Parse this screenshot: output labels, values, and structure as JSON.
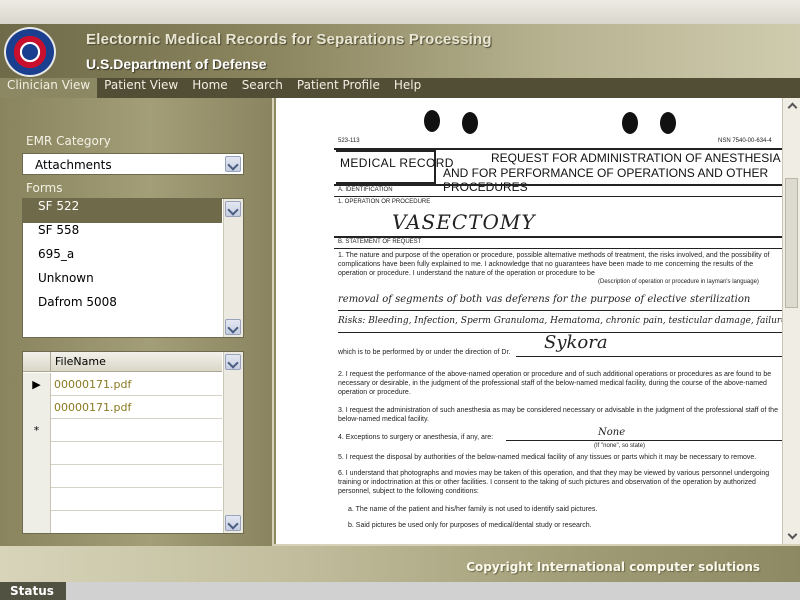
{
  "header": {
    "app_title": "Electornic Medical Records for Separations Processing",
    "org_title": "U.S.Department of Defense",
    "logo_icon": "dod-seal-icon"
  },
  "menu": [
    {
      "label": "Clinician View",
      "active": true
    },
    {
      "label": "Patient View",
      "active": false
    },
    {
      "label": "Home",
      "active": false
    },
    {
      "label": "Search",
      "active": false
    },
    {
      "label": "Patient Profile",
      "active": false
    },
    {
      "label": "Help",
      "active": false
    }
  ],
  "left_panel": {
    "emr_category_label": "EMR Category",
    "emr_category_value": "Attachments",
    "forms_label": "Forms",
    "forms": [
      "SF 522",
      "SF 558",
      "695_a",
      "Unknown",
      "Dafrom 5008"
    ],
    "selected_form": "SF 522",
    "file_grid": {
      "column": "FileName",
      "rows": [
        {
          "marker": "▶",
          "file": "00000171.pdf"
        },
        {
          "marker": "",
          "file": "00000171.pdf"
        },
        {
          "marker": "*",
          "file": ""
        }
      ]
    }
  },
  "document": {
    "form_no": "523-113",
    "nsn": "NSN 7540-00-634-4",
    "record_label": "MEDICAL RECORD",
    "title_line1": "REQUEST FOR ADMINISTRATION OF ANESTHESIA",
    "title_line2": "AND FOR PERFORMANCE OF OPERATIONS AND OTHER PROCEDURES",
    "section_a": "A. IDENTIFICATION",
    "op_label": "1. OPERATION OR PROCEDURE",
    "op_handwritten": "VASECTOMY",
    "section_b": "B. STATEMENT OF REQUEST",
    "para1": "1. The nature and purpose of the operation or procedure, possible alternative methods of treatment, the risks involved, and the possibility of complications have been fully explained to me. I acknowledge that no guarantees have been made to me concerning the results of the operation or procedure. I understand the nature of the operation or procedure to be",
    "lay_note": "(Description of operation or procedure in layman's language)",
    "hand_line1": "removal of segments of both vas deferens for the purpose of elective sterilization",
    "hand_line2": "Risks: Bleeding, Infection, Sperm Granuloma, Hematoma, chronic pain, testicular damage, failure",
    "direction_text": "which is to be performed by or under the direction of Dr.",
    "doctor_handwritten": "Sykora",
    "para2": "2. I request the performance of the above-named operation or procedure and of such additional operations or procedures as are found to be necessary or desirable, in the judgment of the professional staff of the below-named medical facility, during the course of the above-named operation or procedure.",
    "para3": "3. I request the administration of such anesthesia as may be considered necessary or advisable in the judgment of the professional staff of the below-named medical facility.",
    "para4": "4. Exceptions to surgery or anesthesia, if any, are:",
    "none_handwritten": "None",
    "none_note": "(If \"none\", so state)",
    "para5": "5. I request the disposal by authorities of the below-named medical facility of any tissues or parts which it may be necessary to remove.",
    "para6": "6. I understand that photographs and movies may be taken of this operation, and that they may be viewed by various personnel undergoing training or indoctrination at this or other facilities. I consent to the taking of such pictures and observation of the operation by authorized personnel, subject to the following conditions:",
    "cond_a": "a. The name of the patient and his/her family is not used to identify said pictures.",
    "cond_b": "b. Said pictures be used only for purposes of medical/dental study or research."
  },
  "footer": {
    "copyright": "Copyright International computer solutions",
    "status_label": "Status"
  }
}
